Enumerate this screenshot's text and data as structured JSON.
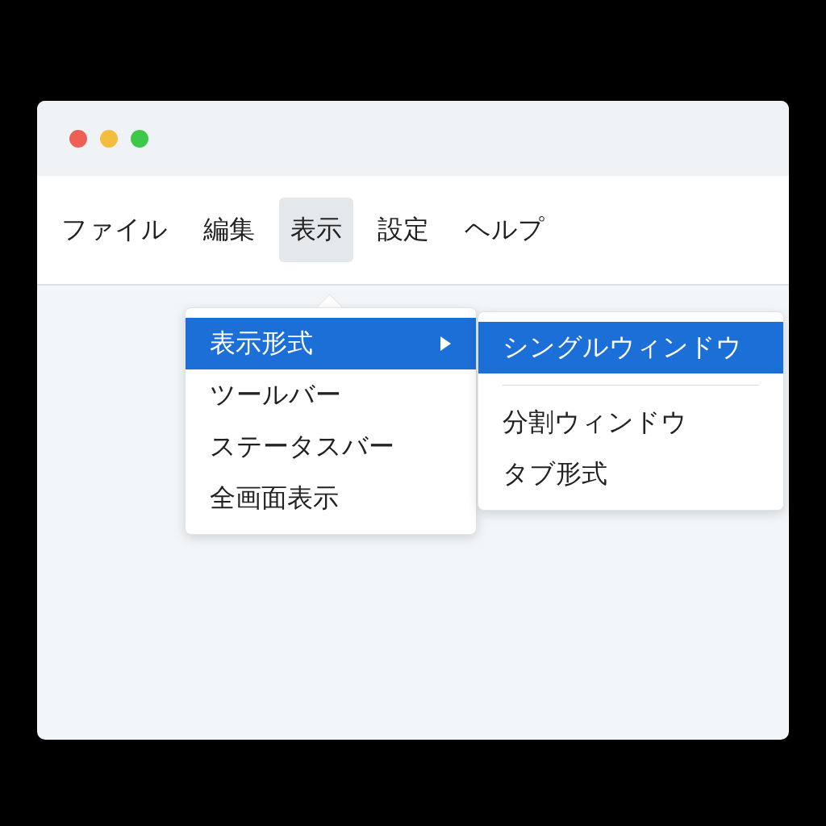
{
  "window": {
    "controls": [
      {
        "color": "#ee5f57"
      },
      {
        "color": "#f4bd3f"
      },
      {
        "color": "#3ec84a"
      }
    ]
  },
  "menu_bar": [
    {
      "label": "ファイル",
      "selected": false
    },
    {
      "label": "編集",
      "selected": false
    },
    {
      "label": "表示",
      "selected": true
    },
    {
      "label": "設定",
      "selected": false
    },
    {
      "label": "ヘルプ",
      "selected": false
    }
  ],
  "dropdown": {
    "items": [
      {
        "label": "表示形式",
        "selected": true,
        "submenu": true
      },
      {
        "label": "ツールバー",
        "selected": false,
        "submenu": false
      },
      {
        "label": "ステータスバー",
        "selected": false,
        "submenu": false
      },
      {
        "label": "全画面表示",
        "selected": false,
        "submenu": false
      }
    ]
  },
  "submenu": {
    "items": [
      {
        "kind": "item",
        "label": "シングルウィンドウ",
        "selected": true
      },
      {
        "kind": "separator"
      },
      {
        "kind": "item",
        "label": "分割ウィンドウ",
        "selected": false
      },
      {
        "kind": "item",
        "label": "タブ形式",
        "selected": false
      }
    ]
  }
}
